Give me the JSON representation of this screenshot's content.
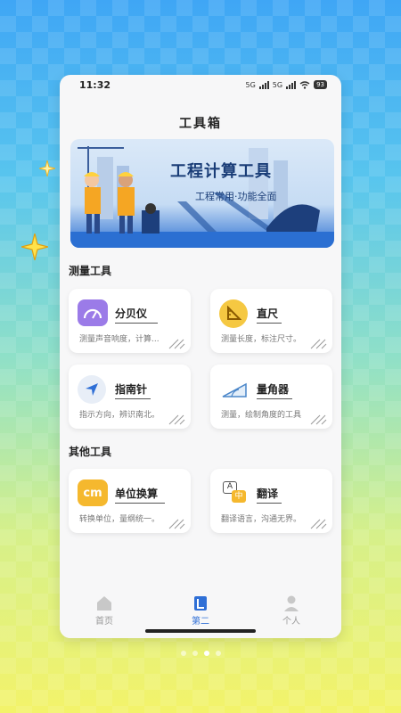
{
  "status_bar": {
    "time": "11:32",
    "signal_1": "5G",
    "signal_2": "5G",
    "battery": "93"
  },
  "page": {
    "title": "工具箱"
  },
  "banner": {
    "title": "工程计算工具",
    "subtitle": "工程常用·功能全面"
  },
  "sections": [
    {
      "title": "测量工具",
      "tools": [
        {
          "name": "分贝仪",
          "desc": "测量声音响度，计算...",
          "icon": "decibel-gauge-icon",
          "color": "#9b7be8"
        },
        {
          "name": "直尺",
          "desc": "测量长度，标注尺寸。",
          "icon": "ruler-icon",
          "color": "#f5c842"
        },
        {
          "name": "指南针",
          "desc": "指示方向，辨识南北。",
          "icon": "compass-arrow-icon",
          "color": "#e8eef7"
        },
        {
          "name": "量角器",
          "desc": "测量，绘制角度的工具",
          "icon": "protractor-icon",
          "color": "#ffffff"
        }
      ]
    },
    {
      "title": "其他工具",
      "tools": [
        {
          "name": "单位换算",
          "desc": "转换单位，量纲统一。",
          "icon": "cm-unit-icon",
          "color": "#f5b82e",
          "icon_text": "cm"
        },
        {
          "name": "翻译",
          "desc": "翻译语言，沟通无界。",
          "icon": "translate-icon",
          "color": "#ffffff",
          "icon_text_1": "A",
          "icon_text_2": "中"
        }
      ]
    }
  ],
  "tabbar": {
    "tabs": [
      {
        "label": "首页",
        "icon": "home-icon",
        "active": false
      },
      {
        "label": "第二",
        "icon": "tools-icon",
        "active": true
      },
      {
        "label": "个人",
        "icon": "person-icon",
        "active": false
      }
    ]
  },
  "carousel": {
    "total": 4,
    "active_index": 2
  },
  "colors": {
    "accent": "#2f6fd6",
    "inactive": "#999999"
  }
}
